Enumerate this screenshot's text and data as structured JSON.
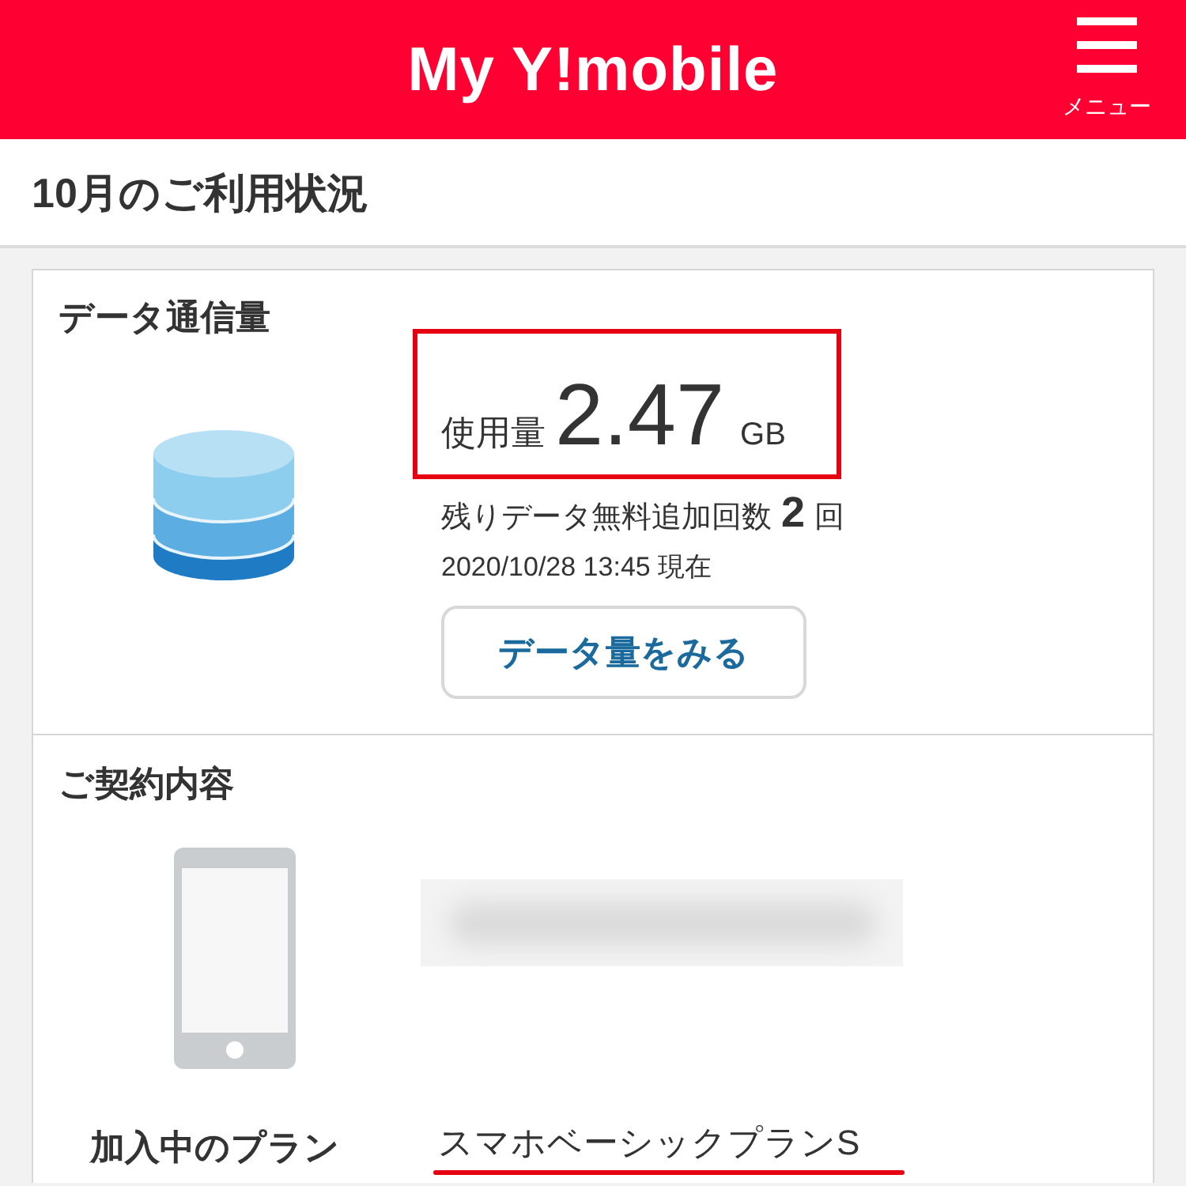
{
  "header": {
    "title": "My Y!mobile",
    "menu_label": "メニュー"
  },
  "page_title": "10月のご利用状況",
  "data_usage": {
    "heading": "データ通信量",
    "usage_label": "使用量",
    "usage_value": "2.47",
    "usage_unit": "GB",
    "highlighted": true,
    "remaining_label": "残りデータ無料追加回数",
    "remaining_count": "2",
    "remaining_unit": "回",
    "timestamp": "2020/10/28 13:45 現在",
    "button": "データ量をみる"
  },
  "contract": {
    "heading": "ご契約内容",
    "plan_label": "加入中のプラン",
    "plan_name": "スマホベーシックプランS",
    "plan_underlined": true
  }
}
